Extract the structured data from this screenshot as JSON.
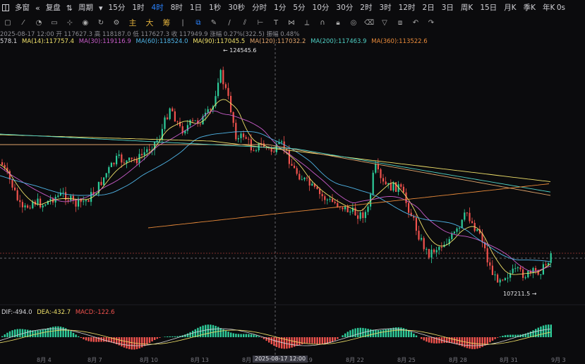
{
  "topbar": {
    "app_name": "多窗",
    "replay": "复盘",
    "period_label": "周期",
    "intervals": [
      "15分",
      "1时",
      "4时",
      "8时",
      "1日",
      "1秒",
      "30秒",
      "分时",
      "1分",
      "5分",
      "10分",
      "30分",
      "2时",
      "3时",
      "12时",
      "2日",
      "3日",
      "周K",
      "15日",
      "月K",
      "季K",
      "年K"
    ],
    "active_interval": "4时",
    "right_label": "0s"
  },
  "toolbar": {
    "cn_tools": [
      "主",
      "大",
      "筹"
    ]
  },
  "ohlc": {
    "date": "2025-08-17 12:00",
    "open": "开 117627.3",
    "high": "高 118187.0",
    "low": "低 117627.3",
    "close": "收 117949.9",
    "change": "涨幅 0.27%(322.5)",
    "amplitude": "振幅 0.48%"
  },
  "ma": [
    {
      "label": "578.1",
      "color": "#d8d8dc"
    },
    {
      "label": "MA(14):117757.4",
      "color": "#f0e16a"
    },
    {
      "label": "MA(30):119116.9",
      "color": "#c85cc9"
    },
    {
      "label": "MA(60):118524.0",
      "color": "#4fb4e6"
    },
    {
      "label": "MA(90):117045.5",
      "color": "#f0e16a"
    },
    {
      "label": "MA(120):117032.2",
      "color": "#e0a36a"
    },
    {
      "label": "MA(200):117463.9",
      "color": "#4fd1c5"
    },
    {
      "label": "MA(360):113522.6",
      "color": "#e88a3a"
    }
  ],
  "annotations": {
    "high": "124545.6",
    "low": "107211.5"
  },
  "macd": {
    "dif": "DIF:-494.0",
    "dea": "DEA:-432.7",
    "macd": "MACD:-122.6"
  },
  "xaxis": {
    "labels": [
      "8月 4",
      "8月 7",
      "8月 10",
      "8月 13",
      "8月",
      "8月 19",
      "8月 22",
      "8月 25",
      "8月 28",
      "8月 31",
      "9月 3"
    ],
    "crosshair": "2025-08-17 12:00"
  },
  "colors": {
    "up": "#2ecc9a",
    "down": "#f0524d",
    "accent": "#2a83ff"
  }
}
